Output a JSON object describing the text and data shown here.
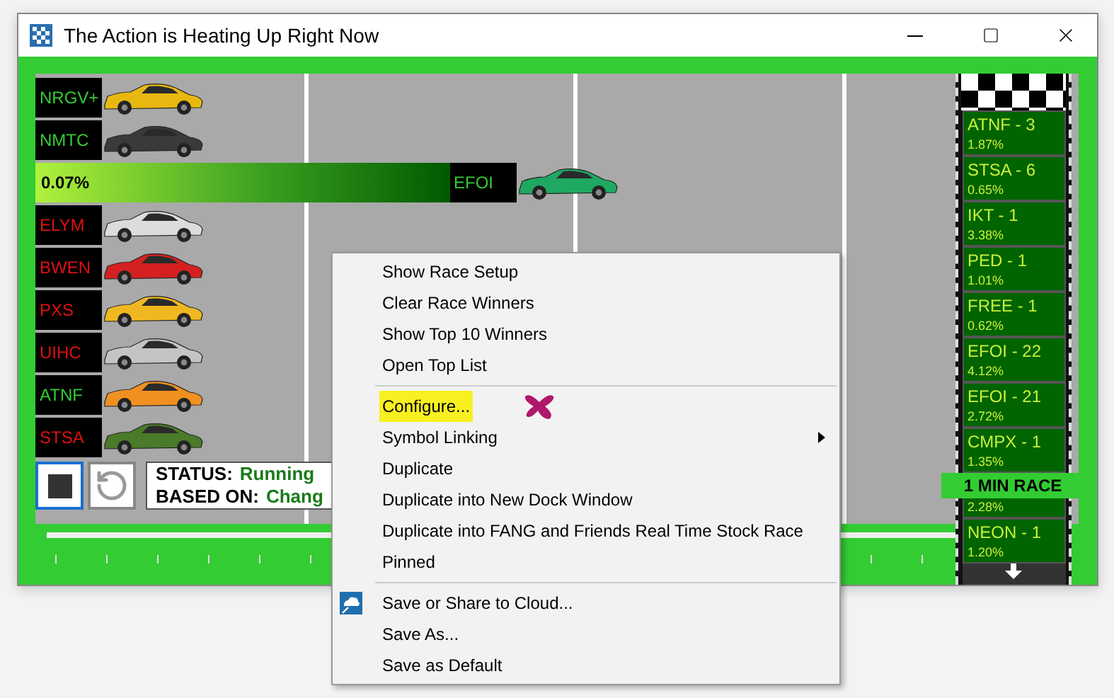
{
  "window": {
    "title": "The Action is Heating Up Right Now"
  },
  "lanes": [
    {
      "kind": "car",
      "symbol": "NRGV+",
      "up": true,
      "color": "#e8b810"
    },
    {
      "kind": "car",
      "symbol": "NMTC",
      "up": true,
      "color": "#3a3a3a"
    },
    {
      "kind": "bar",
      "symbol": "EFOI",
      "up": true,
      "color": "#1fa862",
      "level": 0.45,
      "reading": "0.07%"
    },
    {
      "kind": "car",
      "symbol": "ELYM",
      "up": false,
      "color": "#dcdcdc"
    },
    {
      "kind": "car",
      "symbol": "BWEN",
      "up": false,
      "color": "#d42020"
    },
    {
      "kind": "car",
      "symbol": "PXS",
      "up": false,
      "color": "#f0b820"
    },
    {
      "kind": "car",
      "symbol": "UIHC",
      "up": false,
      "color": "#c4c4c4"
    },
    {
      "kind": "car",
      "symbol": "ATNF",
      "up": true,
      "color": "#f09020"
    },
    {
      "kind": "car",
      "symbol": "STSA",
      "up": false,
      "color": "#4a7a2a"
    }
  ],
  "status": [
    {
      "label": "STATUS:",
      "value": "Running"
    },
    {
      "label": "BASED ON:",
      "value": "Chang"
    }
  ],
  "winners": [
    {
      "name": "ATNF - 3",
      "pct": "1.87%"
    },
    {
      "name": "STSA - 6",
      "pct": "0.65%"
    },
    {
      "name": "IKT - 1",
      "pct": "3.38%"
    },
    {
      "name": "PED - 1",
      "pct": "1.01%"
    },
    {
      "name": "FREE - 1",
      "pct": "0.62%"
    },
    {
      "name": "EFOI - 22",
      "pct": "4.12%"
    },
    {
      "name": "EFOI - 21",
      "pct": "2.72%"
    },
    {
      "name": "CMPX - 1",
      "pct": "1.35%"
    },
    {
      "pct": "2.28%"
    },
    {
      "name": "NEON - 1",
      "pct": "1.20%"
    }
  ],
  "race_badge": "1 MIN RACE",
  "menu": {
    "groups": [
      [
        {
          "kind": "plain",
          "label": "Show Race Setup",
          "highlighted": false
        },
        {
          "kind": "plain",
          "label": "Clear Race Winners",
          "highlighted": false
        },
        {
          "kind": "plain",
          "label": "Show Top 10 Winners",
          "highlighted": false
        },
        {
          "kind": "plain",
          "label": "Open Top List",
          "highlighted": false
        }
      ],
      [
        {
          "kind": "marked",
          "label": "Configure...",
          "highlighted": true
        },
        {
          "kind": "submenu",
          "label": "Symbol Linking",
          "highlighted": false
        },
        {
          "kind": "plain",
          "label": "Duplicate",
          "highlighted": false
        },
        {
          "kind": "plain",
          "label": "Duplicate into New Dock Window",
          "highlighted": false
        },
        {
          "kind": "plain",
          "label": "Duplicate into FANG and Friends Real Time Stock Race",
          "highlighted": false
        },
        {
          "kind": "plain",
          "label": "Pinned",
          "highlighted": false
        }
      ],
      [
        {
          "kind": "cloud",
          "label": "Save or Share to Cloud...",
          "highlighted": false
        },
        {
          "kind": "plain",
          "label": "Save As...",
          "highlighted": false
        },
        {
          "kind": "plain",
          "label": "Save as Default",
          "highlighted": false
        }
      ]
    ]
  }
}
